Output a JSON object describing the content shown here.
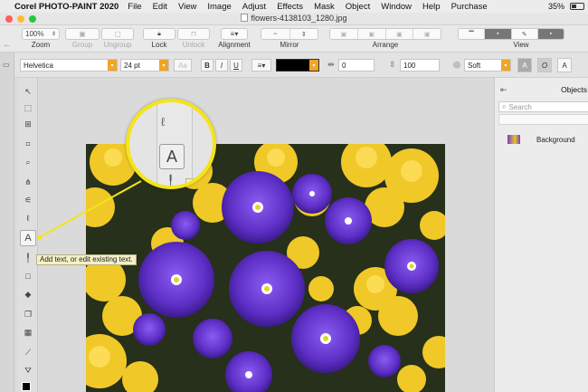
{
  "menubar": {
    "app_name": "Corel PHOTO-PAINT 2020",
    "items": [
      "File",
      "Edit",
      "View",
      "Image",
      "Adjust",
      "Effects",
      "Mask",
      "Object",
      "Window",
      "Help",
      "Purchase"
    ],
    "battery": "35%"
  },
  "window": {
    "title": "flowers-4138103_1280.jpg"
  },
  "toolbar": {
    "zoom_value": "100%",
    "labels": {
      "zoom": "Zoom",
      "group": "Group",
      "ungroup": "Ungroup",
      "lock": "Lock",
      "unlock": "Unlock",
      "alignment": "Alignment",
      "mirror": "Mirror",
      "arrange": "Arrange",
      "view": "View"
    }
  },
  "propbar": {
    "font_family": "Helvetica",
    "font_size": "24 pt",
    "bold": "B",
    "italic": "I",
    "underline": "U",
    "char_spacing": "0",
    "line_spacing": "100",
    "antialias": "Soft",
    "text_color": "#000000"
  },
  "tooltip": {
    "text": "Add text, or edit existing text."
  },
  "magnifier": {
    "text_tool_glyph": "A",
    "partial_label": "Ad"
  },
  "objects_panel": {
    "title": "Objects",
    "search_placeholder": "Search",
    "items": [
      {
        "name": "Background"
      }
    ]
  },
  "colors": {
    "accent_orange": "#f0a526",
    "highlight_yellow": "#f4e41a",
    "tooltip_bg": "#f4f0c7"
  }
}
